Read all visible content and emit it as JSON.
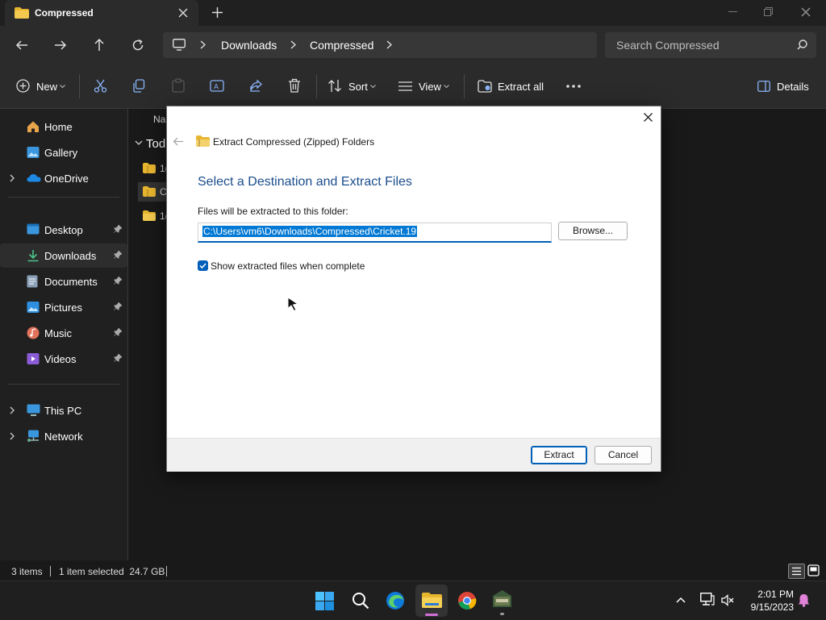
{
  "window": {
    "tab_title": "Compressed"
  },
  "address": {
    "crumbs": [
      "Downloads",
      "Compressed"
    ],
    "search_placeholder": "Search Compressed"
  },
  "toolbar": {
    "new_label": "New",
    "sort_label": "Sort",
    "view_label": "View",
    "extract_all_label": "Extract all",
    "details_label": "Details"
  },
  "sidebar": {
    "items": [
      {
        "label": "Home"
      },
      {
        "label": "Gallery"
      },
      {
        "label": "OneDrive"
      },
      {
        "label": "Desktop"
      },
      {
        "label": "Downloads"
      },
      {
        "label": "Documents"
      },
      {
        "label": "Pictures"
      },
      {
        "label": "Music"
      },
      {
        "label": "Videos"
      },
      {
        "label": "This PC"
      },
      {
        "label": "Network"
      }
    ]
  },
  "content": {
    "column_name": "Na",
    "group_label": "Tod",
    "rows": [
      {
        "label": "1("
      },
      {
        "label": "C"
      },
      {
        "label": "1("
      }
    ]
  },
  "dialog": {
    "title": "Extract Compressed (Zipped) Folders",
    "heading": "Select a Destination and Extract Files",
    "path_label": "Files will be extracted to this folder:",
    "path_value": "C:\\Users\\vm6\\Downloads\\Compressed\\Cricket.19",
    "browse_label": "Browse...",
    "checkbox_label": "Show extracted files when complete",
    "checkbox_checked": true,
    "extract_label": "Extract",
    "cancel_label": "Cancel"
  },
  "status": {
    "items_count": "3 items",
    "selection": "1 item selected  24.7 GB"
  },
  "taskbar": {
    "time": "2:01 PM",
    "date": "9/15/2023"
  },
  "colors": {
    "accent": "#005fb8",
    "folder_yellow": "#e8b52f",
    "heading_blue": "#1b4d8c"
  }
}
